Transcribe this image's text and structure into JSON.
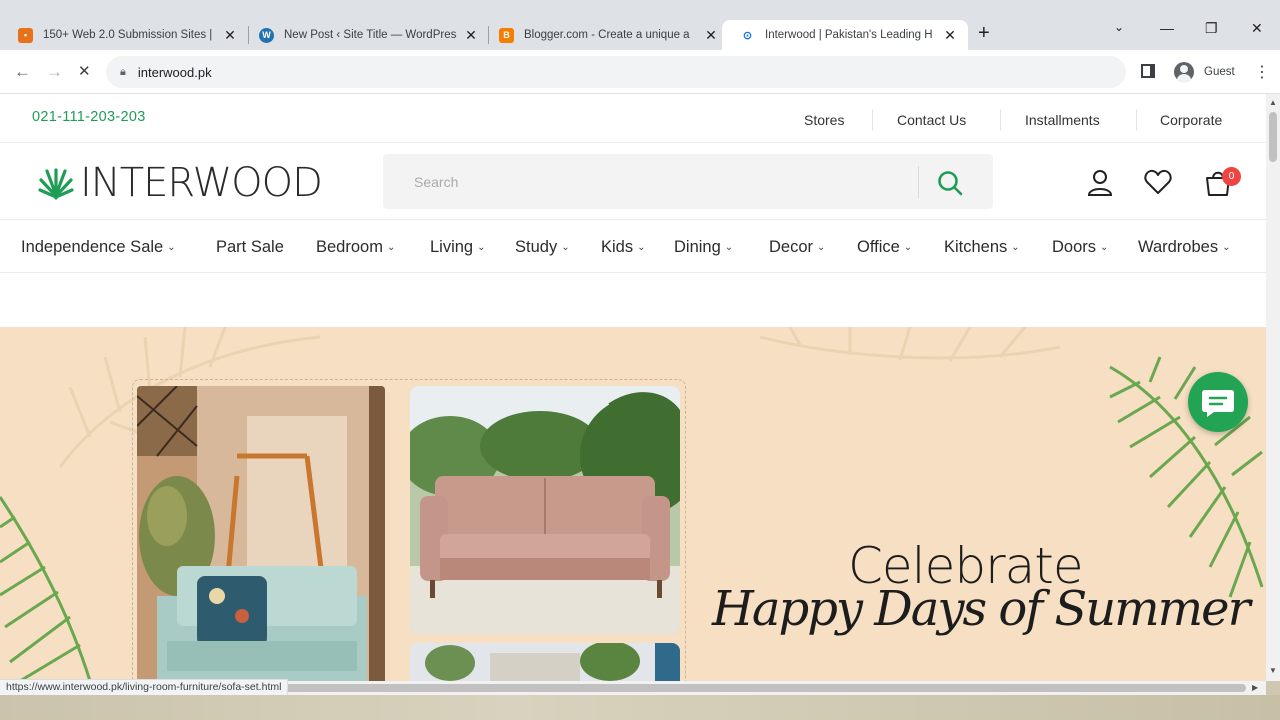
{
  "browser": {
    "tabs": [
      {
        "title": "150+ Web 2.0 Submission Sites |",
        "favicon": "bookmark-favicon-icon",
        "color": "#e8711a"
      },
      {
        "title": "New Post ‹ Site Title — WordPress",
        "favicon": "wordpress-favicon-icon",
        "color": "#2271b1"
      },
      {
        "title": "Blogger.com - Create a unique a",
        "favicon": "blogger-favicon-icon",
        "color": "#f57d00"
      },
      {
        "title": "Interwood | Pakistan's Leading H",
        "favicon": "interwood-favicon-icon",
        "color": "#1f9d55"
      }
    ],
    "url": "interwood.pk",
    "profile_label": "Guest",
    "status_url": "https://www.interwood.pk/living-room-furniture/sofa-set.html"
  },
  "topbar": {
    "phone": "021-111-203-203",
    "links": [
      "Stores",
      "Contact Us",
      "Installments",
      "Corporate"
    ]
  },
  "header": {
    "logo_text": "INTERWOOD",
    "search_placeholder": "Search",
    "cart_count": "0",
    "brand_color": "#1f9d55"
  },
  "nav": {
    "items": [
      {
        "label": "Independence Sale",
        "dropdown": true
      },
      {
        "label": "Part Sale",
        "dropdown": false
      },
      {
        "label": "Bedroom",
        "dropdown": true
      },
      {
        "label": "Living",
        "dropdown": true
      },
      {
        "label": "Study",
        "dropdown": true
      },
      {
        "label": "Kids",
        "dropdown": true
      },
      {
        "label": "Dining",
        "dropdown": true
      },
      {
        "label": "Decor",
        "dropdown": true
      },
      {
        "label": "Office",
        "dropdown": true
      },
      {
        "label": "Kitchens",
        "dropdown": true
      },
      {
        "label": "Doors",
        "dropdown": true
      },
      {
        "label": "Wardrobes",
        "dropdown": true
      }
    ]
  },
  "hero": {
    "heading": "Celebrate",
    "script_text": "Happy Days of Summer",
    "background_color": "#f6dfc3"
  }
}
